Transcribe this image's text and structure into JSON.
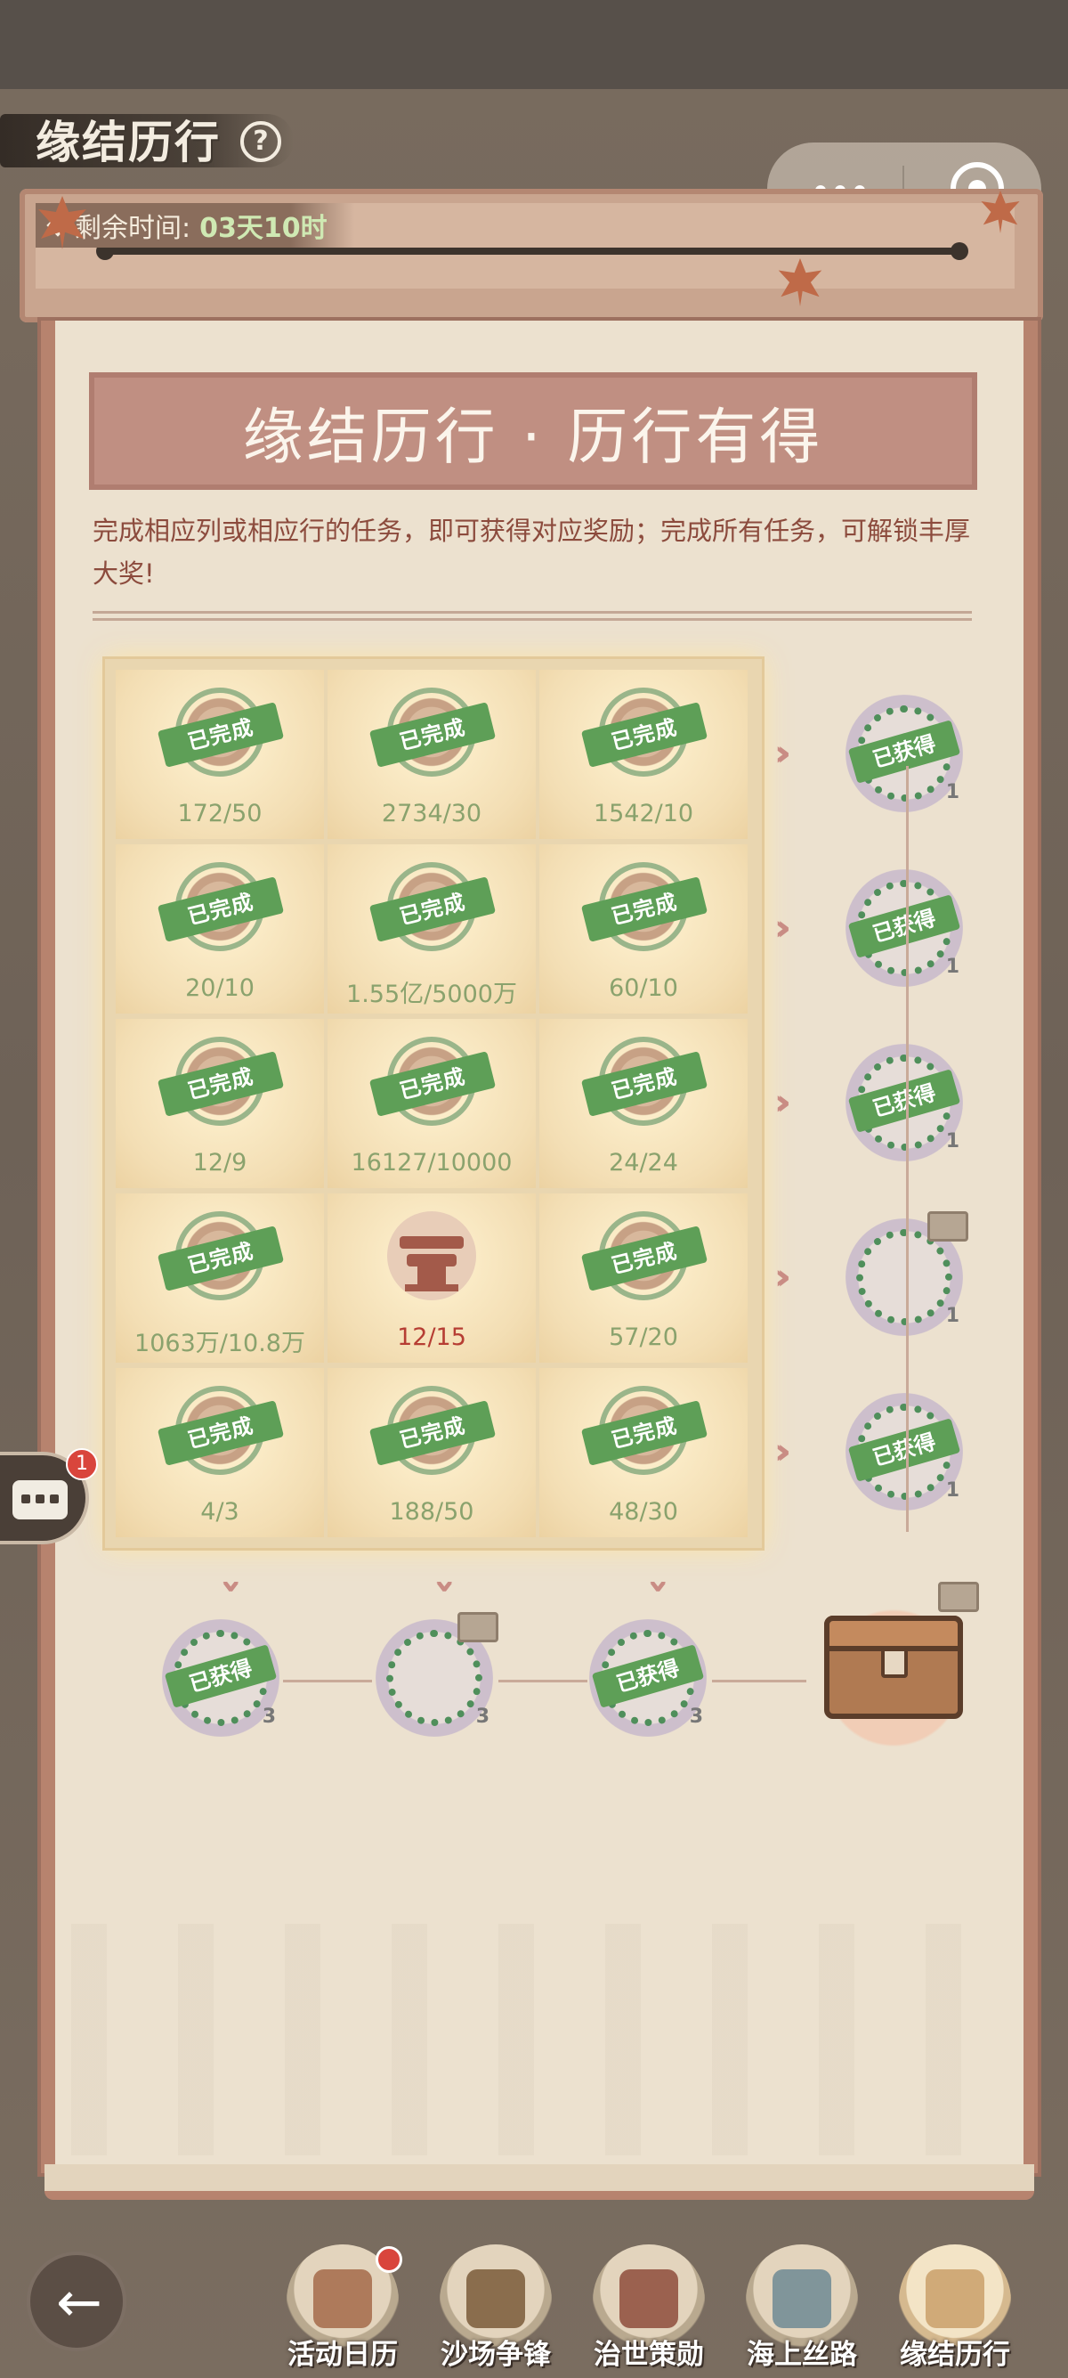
{
  "page": {
    "title": "缘结历行",
    "help_icon": "?"
  },
  "capsule": {
    "more_icon": "more-dots-icon",
    "close_icon": "target-close-icon"
  },
  "timer": {
    "label": "剩余时间:",
    "value": "03天10时"
  },
  "banner": {
    "title": "缘结历行 · 历行有得"
  },
  "description": "完成相应列或相应行的任务，即可获得对应奖励；完成所有任务，可解锁丰厚大奖!",
  "grid": {
    "completed_stamp": "已完成",
    "rows": [
      [
        {
          "progress": "172/50",
          "done": true
        },
        {
          "progress": "2734/30",
          "done": true
        },
        {
          "progress": "1542/10",
          "done": true
        }
      ],
      [
        {
          "progress": "20/10",
          "done": true
        },
        {
          "progress": "1.55亿/5000万",
          "done": true
        },
        {
          "progress": "60/10",
          "done": true
        }
      ],
      [
        {
          "progress": "12/9",
          "done": true
        },
        {
          "progress": "16127/10000",
          "done": true
        },
        {
          "progress": "24/24",
          "done": true
        }
      ],
      [
        {
          "progress": "1063万/10.8万",
          "done": true
        },
        {
          "progress": "12/15",
          "done": false
        },
        {
          "progress": "57/20",
          "done": true
        }
      ],
      [
        {
          "progress": "4/3",
          "done": true
        },
        {
          "progress": "188/50",
          "done": true
        },
        {
          "progress": "48/30",
          "done": true
        }
      ]
    ]
  },
  "row_rewards": [
    {
      "obtained": true,
      "stamp": "已获得",
      "count": "1"
    },
    {
      "obtained": true,
      "stamp": "已获得",
      "count": "1"
    },
    {
      "obtained": true,
      "stamp": "已获得",
      "count": "1"
    },
    {
      "obtained": false,
      "stamp": "",
      "count": "1"
    },
    {
      "obtained": true,
      "stamp": "已获得",
      "count": "1"
    }
  ],
  "column_rewards": [
    {
      "obtained": true,
      "stamp": "已获得",
      "count": "3"
    },
    {
      "obtained": false,
      "stamp": "",
      "count": "3"
    },
    {
      "obtained": true,
      "stamp": "已获得",
      "count": "3"
    }
  ],
  "grand_prize": {
    "icon": "treasure-chest-icon"
  },
  "side_chat": {
    "badge": "1"
  },
  "bottom_nav": {
    "items": [
      {
        "label": "活动日历",
        "has_dot": true,
        "active": false
      },
      {
        "label": "沙场争锋",
        "has_dot": false,
        "active": false
      },
      {
        "label": "治世策勋",
        "has_dot": false,
        "active": false
      },
      {
        "label": "海上丝路",
        "has_dot": false,
        "active": false
      },
      {
        "label": "缘结历行",
        "has_dot": false,
        "active": true
      }
    ]
  },
  "colors": {
    "completed_green": "#5e9f57",
    "progress_done": "#8aa26d",
    "progress_incomplete": "#b63d33",
    "banner": "#c08f82",
    "paper": "#ece1cf"
  }
}
